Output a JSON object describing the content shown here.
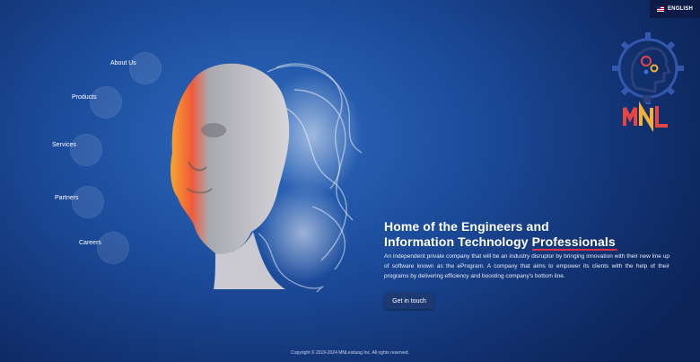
{
  "header": {
    "language_label": "ENGLISH",
    "flag_icon": "us-flag-icon"
  },
  "nav": {
    "items": [
      {
        "label": "About Us"
      },
      {
        "label": "Products"
      },
      {
        "label": "Services"
      },
      {
        "label": "Partners"
      },
      {
        "label": "Careers"
      }
    ]
  },
  "logo": {
    "text": "MNL",
    "icon": "gear-head-lightbulb-icon",
    "colors": [
      "#e84545",
      "#f3b03a",
      "#3a6fd8"
    ]
  },
  "hero": {
    "title_line1": "Home of the Engineers and",
    "title_line2_prefix": "Information Technology ",
    "title_highlight": "Professionals",
    "accent_color": "#e8304a",
    "description": "An independent private company that will be an industry disruptor by bringing innovation with their new line up of software known as the eProgram. A company that aims to empower its clients with the help of their programs by delivering efficiency and boosting company's bottom line.",
    "cta_label": "Get in touch"
  },
  "footer": {
    "copyright": "Copyright © 2019-2024 MNLeistung Inc. All rights reserved."
  }
}
